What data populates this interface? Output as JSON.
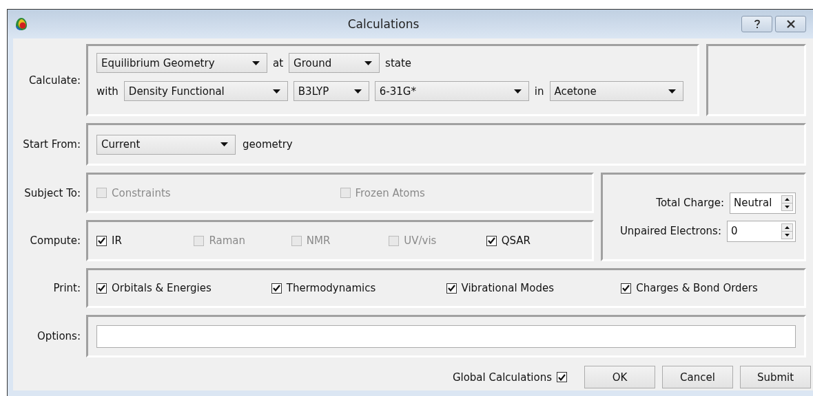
{
  "window": {
    "title": "Calculations"
  },
  "calculate": {
    "label": "Calculate:",
    "rows": [
      {
        "items": [
          {
            "kind": "combo",
            "value": "Equilibrium Geometry"
          },
          {
            "kind": "text",
            "text": "at"
          },
          {
            "kind": "combo",
            "value": "Ground"
          },
          {
            "kind": "text",
            "text": "state"
          }
        ]
      },
      {
        "items": [
          {
            "kind": "text",
            "text": "with"
          },
          {
            "kind": "combo",
            "value": "Density Functional"
          },
          {
            "kind": "combo",
            "value": "B3LYP"
          },
          {
            "kind": "combo",
            "value": "6-31G*"
          },
          {
            "kind": "text",
            "text": "in"
          },
          {
            "kind": "combo",
            "value": "Acetone"
          }
        ]
      }
    ]
  },
  "start_from": {
    "label": "Start From:",
    "items": [
      {
        "kind": "combo",
        "value": "Current"
      },
      {
        "kind": "text",
        "text": "geometry"
      }
    ]
  },
  "subject_to": {
    "label": "Subject To:",
    "options": [
      {
        "label": "Constraints",
        "checked": false,
        "disabled": true
      },
      {
        "label": "Frozen Atoms",
        "checked": false,
        "disabled": true
      }
    ]
  },
  "compute": {
    "label": "Compute:",
    "options": [
      {
        "label": "IR",
        "checked": true,
        "disabled": false
      },
      {
        "label": "Raman",
        "checked": false,
        "disabled": true
      },
      {
        "label": "NMR",
        "checked": false,
        "disabled": true
      },
      {
        "label": "UV/vis",
        "checked": false,
        "disabled": true
      },
      {
        "label": "QSAR",
        "checked": true,
        "disabled": false
      }
    ]
  },
  "charge": {
    "total_charge": {
      "label": "Total Charge:",
      "value": "Neutral"
    },
    "unpaired_electrons": {
      "label": "Unpaired Electrons:",
      "value": "0"
    }
  },
  "print": {
    "label": "Print:",
    "options": [
      {
        "label": "Orbitals & Energies",
        "checked": true,
        "disabled": false
      },
      {
        "label": "Thermodynamics",
        "checked": true,
        "disabled": false
      },
      {
        "label": "Vibrational Modes",
        "checked": true,
        "disabled": false
      },
      {
        "label": "Charges & Bond Orders",
        "checked": true,
        "disabled": false
      }
    ]
  },
  "options": {
    "label": "Options:"
  },
  "global_calculations": {
    "label": "Global Calculations",
    "checked": true
  },
  "buttons": [
    "OK",
    "Cancel",
    "Submit"
  ]
}
